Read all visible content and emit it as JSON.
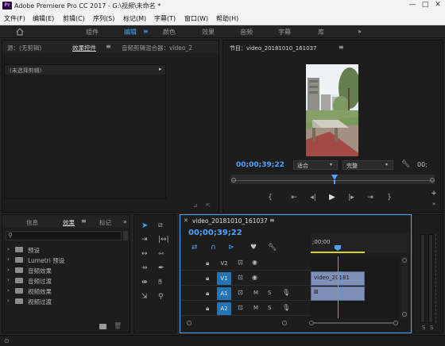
{
  "window": {
    "title": "Adobe Premiere Pro CC 2017 - G:\\视频\\未命名 *",
    "app_icon": "Pr",
    "minimize": "—",
    "maximize": "□",
    "close": "✕"
  },
  "menu": [
    "文件(F)",
    "编辑(E)",
    "剪辑(C)",
    "序列(S)",
    "标记(M)",
    "字幕(T)",
    "窗口(W)",
    "帮助(H)"
  ],
  "workspaces": {
    "home_icon": "home-icon",
    "items": [
      "组件",
      "编辑",
      "颜色",
      "效果",
      "音频",
      "字幕",
      "库"
    ],
    "active": "编辑",
    "more": "»"
  },
  "source_panel": {
    "tabs": [
      "源：(无剪辑)",
      "效果控件",
      "音频剪辑混合器：video_2"
    ],
    "active_tab": "效果控件",
    "no_clip": "(未选择剪辑)"
  },
  "program_panel": {
    "title": "节目：video_20181010_161037",
    "timecode": "00;00;39;22",
    "fit": "适合",
    "quality": "完整",
    "colors": {
      "accent": "#4fa3ff"
    }
  },
  "project_panel": {
    "tabs": [
      "信息",
      "效果",
      "标记"
    ],
    "active_tab": "效果",
    "more": "»",
    "items": [
      "预设",
      "Lumetri 预设",
      "音频效果",
      "音频过渡",
      "视频效果",
      "视频过渡"
    ]
  },
  "timeline": {
    "sequence_tab": "video_20181010_161037",
    "timecode": "00;00;39;22",
    "ruler_label": ";00;00",
    "tracks": [
      {
        "name": "V2",
        "type": "video"
      },
      {
        "name": "V1",
        "type": "video"
      },
      {
        "name": "A1",
        "type": "audio"
      },
      {
        "name": "A2",
        "type": "audio"
      }
    ],
    "video_clip": "video_20181",
    "mute": "M",
    "solo": "S"
  }
}
